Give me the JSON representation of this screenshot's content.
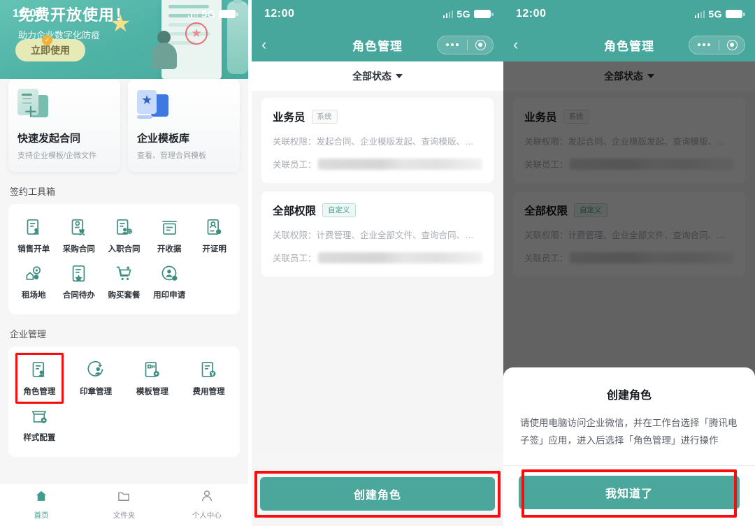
{
  "status_bar": {
    "time": "12:00",
    "network": "5G",
    "signal_icon": "signal-bars-icon",
    "battery_icon": "battery-icon"
  },
  "panel_home": {
    "hero": {
      "headline": "免费开放使用！",
      "subhead": "助力企业数字化防疫",
      "cta_label": "立即使用",
      "star_icon": "star-icon",
      "stamp_icon": "stamp-star-icon",
      "person_icon": "person-illustration-icon",
      "badge_icon": "check-badge-icon"
    },
    "feature_cards": [
      {
        "title": "快速发起合同",
        "subtitle": "支持企业模板/企微文件",
        "icon": "document-add-icon"
      },
      {
        "title": "企业模板库",
        "subtitle": "查看、管理合同模板",
        "icon": "template-star-icon"
      }
    ],
    "toolbox": {
      "section_title": "签约工具箱",
      "items": [
        {
          "label": "销售开单",
          "icon": "doc-person-icon"
        },
        {
          "label": "采购合同",
          "icon": "doc-cart-icon"
        },
        {
          "label": "入职合同",
          "icon": "doc-person-add-icon"
        },
        {
          "label": "开收据",
          "icon": "receipt-icon"
        },
        {
          "label": "开证明",
          "icon": "certificate-icon"
        },
        {
          "label": "租场地",
          "icon": "venue-location-icon"
        },
        {
          "label": "合同待办",
          "icon": "doc-star-icon"
        },
        {
          "label": "购买套餐",
          "icon": "cart-plus-icon"
        },
        {
          "label": "用印申请",
          "icon": "seal-apply-icon"
        }
      ]
    },
    "enterprise": {
      "section_title": "企业管理",
      "items": [
        {
          "label": "角色管理",
          "icon": "doc-person-icon",
          "highlighted": true
        },
        {
          "label": "印章管理",
          "icon": "seal-manage-icon",
          "highlighted": false
        },
        {
          "label": "模板管理",
          "icon": "template-gear-icon",
          "highlighted": false
        },
        {
          "label": "费用管理",
          "icon": "doc-fee-icon",
          "highlighted": false
        },
        {
          "label": "样式配置",
          "icon": "style-gear-icon",
          "highlighted": false
        }
      ]
    },
    "tabbar": [
      {
        "label": "首页",
        "icon": "home-icon",
        "active": true
      },
      {
        "label": "文件夹",
        "icon": "folder-icon",
        "active": false
      },
      {
        "label": "个人中心",
        "icon": "user-icon",
        "active": false
      }
    ]
  },
  "panel_roles": {
    "nav": {
      "title": "角色管理",
      "back_icon": "chevron-left-icon",
      "more_icon": "more-dots-icon",
      "target_icon": "target-circle-icon"
    },
    "filter": {
      "label": "全部状态",
      "caret_icon": "chevron-down-icon"
    },
    "cards": [
      {
        "name": "业务员",
        "badge": "系统",
        "badge_type": "sys",
        "permission_label": "关联权限：",
        "permission_value": "发起合同、企业模版发起、查询模版、…",
        "employee_label": "关联员工：",
        "employee_value": ""
      },
      {
        "name": "全部权限",
        "badge": "自定义",
        "badge_type": "custom",
        "permission_label": "关联权限：",
        "permission_value": "计费管理、企业全部文件、查询合同、…",
        "employee_label": "关联员工：",
        "employee_value": ""
      }
    ],
    "create_button": "创建角色"
  },
  "panel_modal": {
    "modal": {
      "title": "创建角色",
      "body": "请使用电脑访问企业微信，并在工作台选择「腾讯电子签」应用，进入后选择「角色管理」进行操作",
      "confirm_label": "我知道了"
    }
  },
  "colors": {
    "teal": "#48a79c",
    "button_teal": "#4ba79c",
    "highlight_red": "#f60d0d",
    "badge_custom": "#3f9c8e"
  }
}
